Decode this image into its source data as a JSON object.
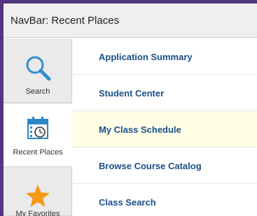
{
  "header": {
    "title": "NavBar: Recent Places"
  },
  "rail": {
    "items": [
      {
        "label": "Search",
        "icon": "search-icon"
      },
      {
        "label": "Recent Places",
        "icon": "calendar-clock-icon",
        "active": true
      },
      {
        "label": "My Favorites",
        "icon": "star-icon"
      }
    ]
  },
  "list": {
    "items": [
      {
        "label": "Application Summary"
      },
      {
        "label": "Student Center"
      },
      {
        "label": "My Class Schedule",
        "highlighted": true
      },
      {
        "label": "Browse Course Catalog"
      },
      {
        "label": "Class Search"
      }
    ]
  },
  "colors": {
    "frame": "#54357f",
    "link": "#1a4f8a",
    "highlight": "#fffde6",
    "star": "#f59b14",
    "search": "#2f8fd0",
    "calendar": "#2e86c8"
  }
}
